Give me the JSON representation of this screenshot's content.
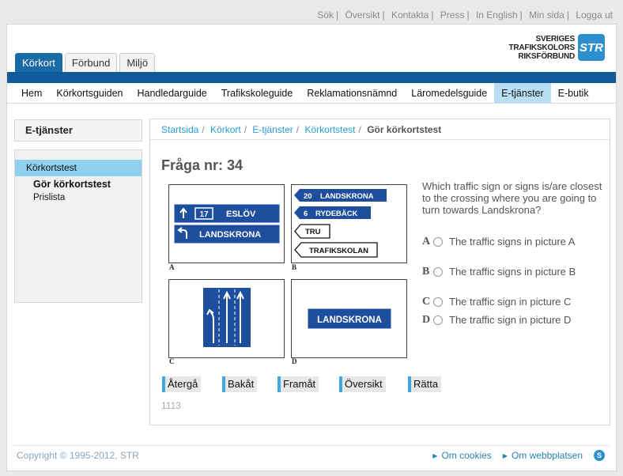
{
  "top_links": [
    "Sök",
    "Översikt",
    "Kontakta",
    "Press",
    "In English",
    "Min sida",
    "Logga ut"
  ],
  "logo": {
    "line1": "SVERIGES",
    "line2": "TRAFIKSKOLORS",
    "line3": "RIKSFÖRBUND",
    "mark": "STR"
  },
  "tabs": [
    "Körkort",
    "Förbund",
    "Miljö"
  ],
  "nav": [
    "Hem",
    "Körkortsguiden",
    "Handledarguide",
    "Trafikskoleguide",
    "Reklamationsnämnd",
    "Läromedelsguide",
    "E-tjänster",
    "E-butik"
  ],
  "sidebar": {
    "title": "E-tjänster",
    "items": [
      "Körkortstest",
      "Gör körkortstest",
      "Prislista"
    ]
  },
  "breadcrumb": {
    "items": [
      "Startsida",
      "Körkort",
      "E-tjänster",
      "Körkortstest"
    ],
    "separator": "/",
    "current": "Gör körkortstest"
  },
  "question": {
    "title": "Fråga nr: 34",
    "text": "Which traffic sign or signs is/are closest to the crossing where you are going to turn towards Landskrona?",
    "answers": [
      {
        "letter": "A",
        "text": "The traffic signs in picture A"
      },
      {
        "letter": "B",
        "text": "The traffic signs in picture B"
      },
      {
        "letter": "C",
        "text": "The traffic sign in picture C"
      },
      {
        "letter": "D",
        "text": "The traffic sign in picture D"
      }
    ]
  },
  "pictures": {
    "a": {
      "label": "A",
      "route": "17",
      "town1": "ESLÖV",
      "town2": "LANDSKRONA"
    },
    "b": {
      "label": "B",
      "s1_num": "20",
      "s1": "LANDSKRONA",
      "s2_num": "6",
      "s2": "RYDEBÄCK",
      "s3": "TRU",
      "s4": "TRAFIKSKOLAN"
    },
    "c": {
      "label": "C"
    },
    "d": {
      "label": "D",
      "town": "LANDSKRONA"
    }
  },
  "buttons": [
    "Återgå",
    "Bakåt",
    "Framåt",
    "Översikt",
    "Rätta"
  ],
  "question_number": "1113",
  "footer": {
    "copyright": "Copyright © 1995-2012, STR",
    "links": [
      "Om cookies",
      "Om webbplatsen"
    ]
  },
  "colors": {
    "brand_blue": "#0f5a98",
    "accent_light": "#8fd0ee",
    "link": "#2a9ad1",
    "sign_blue": "#1e4e9e"
  }
}
